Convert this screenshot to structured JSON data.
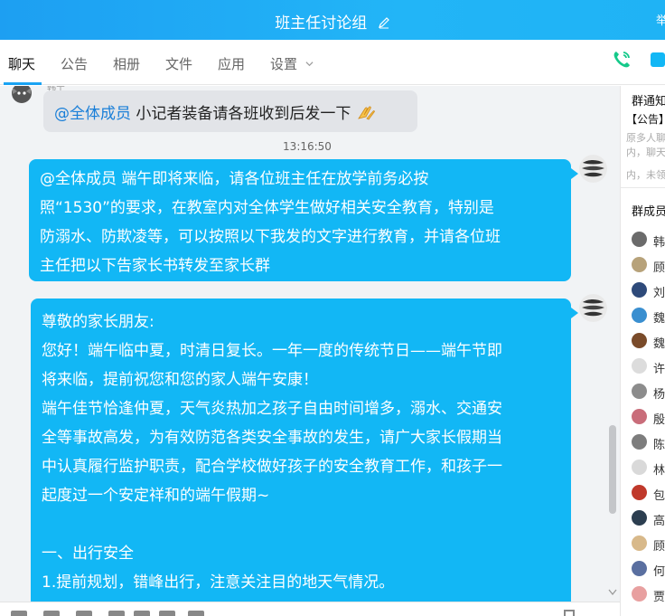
{
  "window": {
    "title": "班主任讨论组",
    "corner_text": "举"
  },
  "tabs": [
    {
      "label": "聊天",
      "active": true
    },
    {
      "label": "公告",
      "active": false
    },
    {
      "label": "相册",
      "active": false
    },
    {
      "label": "文件",
      "active": false
    },
    {
      "label": "应用",
      "active": false
    },
    {
      "label": "设置",
      "active": false
    }
  ],
  "chat": {
    "msg1": {
      "sender": "韩宁",
      "mention": "@全体成员",
      "text": " 小记者装备请各班收到后发一下"
    },
    "timestamp": "13:16:50",
    "msg2": {
      "lines": [
        "@全体成员 端午即将来临，请各位班主任在放学前务必按",
        "照“1530”的要求，在教室内对全体学生做好相关安全教育，特别是",
        "防溺水、防欺凌等，可以按照以下我发的文字进行教育，并请各位班",
        "主任把以下告家长书转发至家长群"
      ]
    },
    "msg3": {
      "lines": [
        "尊敬的家长朋友:",
        "您好！端午临中夏，时清日复长。一年一度的传统节日——端午节即",
        "将来临，提前祝您和您的家人端午安康！",
        "端午佳节恰逢仲夏，天气炎热加之孩子自由时间增多，溺水、交通安",
        "全等事故高发，为有效防范各类安全事故的发生，请广大家长假期当",
        "中认真履行监护职责，配合学校做好孩子的安全教育工作，和孩子一",
        "起度过一个安定祥和的端午假期~",
        "",
        "一、出行安全",
        "1.提前规划，错峰出行，注意关注目的地天气情况。"
      ]
    }
  },
  "side": {
    "notice_title": "群通知",
    "notice_lines": [
      "【公告】",
      "原多人聊",
      "内，聊天",
      "内，未领"
    ],
    "members_title": "群成员",
    "members": [
      {
        "name": "韩",
        "color": "#6b6b6b"
      },
      {
        "name": "顾",
        "color": "#b7a27a"
      },
      {
        "name": "刘",
        "color": "#2e4a7a"
      },
      {
        "name": "魏",
        "color": "#3a8fd0"
      },
      {
        "name": "魏",
        "color": "#7a4b2a"
      },
      {
        "name": "许",
        "color": "#dcdcdc"
      },
      {
        "name": "杨",
        "color": "#8c8c8c"
      },
      {
        "name": "殷",
        "color": "#c96d7a"
      },
      {
        "name": "陈",
        "color": "#7d7d7d"
      },
      {
        "name": "林",
        "color": "#d9d9d9"
      },
      {
        "name": "包",
        "color": "#c0392b"
      },
      {
        "name": "高",
        "color": "#2c3e50"
      },
      {
        "name": "顾",
        "color": "#d8b98a"
      },
      {
        "name": "何",
        "color": "#5a6fa0"
      },
      {
        "name": "贾",
        "color": "#e8a0a0"
      }
    ]
  },
  "colors": {
    "accent": "#1aa3f3",
    "bubble_blue": "#12b7f5",
    "bubble_grey": "#e2e4e8",
    "mention": "#1a7fd8",
    "call_green": "#15c98a"
  }
}
